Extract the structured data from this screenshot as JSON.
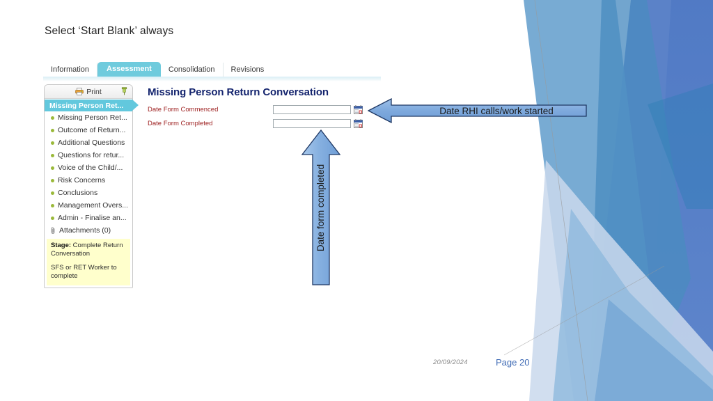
{
  "slide": {
    "heading": "Select ‘Start Blank’ always"
  },
  "app": {
    "tabs": [
      {
        "label": "Information",
        "active": false
      },
      {
        "label": "Assessment",
        "active": true
      },
      {
        "label": "Consolidation",
        "active": false
      },
      {
        "label": "Revisions",
        "active": false
      }
    ],
    "sidebar": {
      "toolbar": {
        "print_label": "Print",
        "print_icon": "printer-icon",
        "pin_icon": "pin-icon"
      },
      "active_item": "Missing Person Ret...",
      "items": [
        {
          "label": "Missing Person Ret...",
          "icon": "bullet-icon"
        },
        {
          "label": "Outcome of Return...",
          "icon": "bullet-icon"
        },
        {
          "label": "Additional Questions",
          "icon": "bullet-icon"
        },
        {
          "label": "Questions for retur...",
          "icon": "bullet-icon"
        },
        {
          "label": "Voice of the Child/...",
          "icon": "bullet-icon"
        },
        {
          "label": "Risk Concerns",
          "icon": "bullet-icon"
        },
        {
          "label": "Conclusions",
          "icon": "bullet-icon"
        },
        {
          "label": "Management Overs...",
          "icon": "bullet-icon"
        },
        {
          "label": "Admin - Finalise an...",
          "icon": "bullet-icon"
        },
        {
          "label": "Attachments (0)",
          "icon": "paperclip-icon"
        }
      ],
      "stage_label": "Stage:",
      "stage_value": " Complete Return Conversation",
      "note": "SFS or RET Worker to complete"
    },
    "form": {
      "title": "Missing Person Return Conversation",
      "rows": [
        {
          "label": "Date Form Commenced",
          "value": "",
          "calendar_icon": "calendar-icon"
        },
        {
          "label": "Date Form Completed",
          "value": "",
          "calendar_icon": "calendar-icon"
        }
      ]
    }
  },
  "callouts": {
    "right_arrow": {
      "text": "Date RHI calls/work started",
      "direction": "left",
      "fill": "#7fa8dd",
      "border": "#1f3864"
    },
    "up_arrow": {
      "text": "Date form completed",
      "direction": "up",
      "fill": "#7fa8dd",
      "border": "#1f3864"
    }
  },
  "footer": {
    "date": "20/09/2024",
    "page": "Page 20"
  },
  "theme": {
    "accent_teal": "#62c8dd",
    "title_navy": "#14246e",
    "label_red": "#9c1d1d",
    "page_blue": "#3f6bb5",
    "highlight_yellow": "#ffffcc"
  }
}
